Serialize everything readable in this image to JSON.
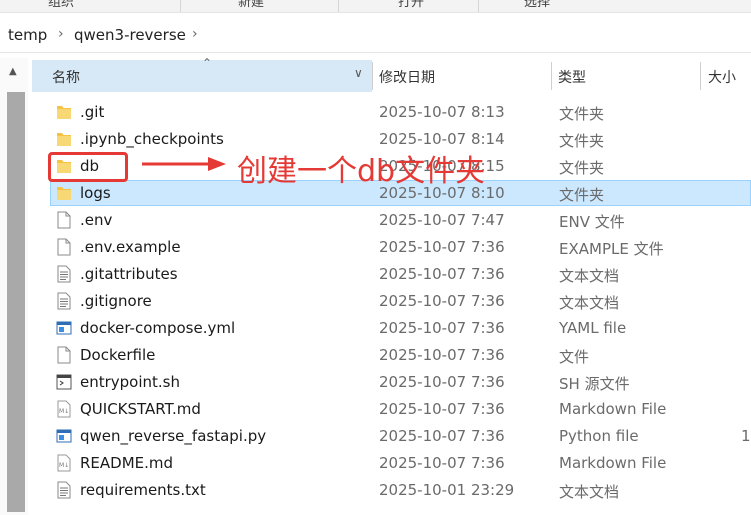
{
  "ribbon": {
    "items": [
      "组织",
      "新建",
      "打开",
      "选择"
    ]
  },
  "breadcrumb": {
    "items": [
      "temp",
      "qwen3-reverse"
    ]
  },
  "columns": {
    "name": "名称",
    "date": "修改日期",
    "type": "类型",
    "size": "大小"
  },
  "files": [
    {
      "name": ".git",
      "date": "2025-10-07 8:13",
      "type": "文件夹",
      "size": "",
      "icon": "folder"
    },
    {
      "name": ".ipynb_checkpoints",
      "date": "2025-10-07 8:14",
      "type": "文件夹",
      "size": "",
      "icon": "folder"
    },
    {
      "name": "db",
      "date": "2025-10-07 8:15",
      "type": "文件夹",
      "size": "",
      "icon": "folder"
    },
    {
      "name": "logs",
      "date": "2025-10-07 8:10",
      "type": "文件夹",
      "size": "",
      "icon": "folder"
    },
    {
      "name": ".env",
      "date": "2025-10-07 7:47",
      "type": "ENV 文件",
      "size": "",
      "icon": "blank-file"
    },
    {
      "name": ".env.example",
      "date": "2025-10-07 7:36",
      "type": "EXAMPLE 文件",
      "size": "",
      "icon": "blank-file"
    },
    {
      "name": ".gitattributes",
      "date": "2025-10-07 7:36",
      "type": "文本文档",
      "size": "",
      "icon": "text-file"
    },
    {
      "name": ".gitignore",
      "date": "2025-10-07 7:36",
      "type": "文本文档",
      "size": "",
      "icon": "text-file"
    },
    {
      "name": "docker-compose.yml",
      "date": "2025-10-07 7:36",
      "type": "YAML file",
      "size": "",
      "icon": "app-file"
    },
    {
      "name": "Dockerfile",
      "date": "2025-10-07 7:36",
      "type": "文件",
      "size": "",
      "icon": "blank-file"
    },
    {
      "name": "entrypoint.sh",
      "date": "2025-10-07 7:36",
      "type": "SH 源文件",
      "size": "",
      "icon": "script-file"
    },
    {
      "name": "QUICKSTART.md",
      "date": "2025-10-07 7:36",
      "type": "Markdown File",
      "size": "",
      "icon": "markdown-file"
    },
    {
      "name": "qwen_reverse_fastapi.py",
      "date": "2025-10-07 7:36",
      "type": "Python file",
      "size": "1",
      "icon": "app-file"
    },
    {
      "name": "README.md",
      "date": "2025-10-07 7:36",
      "type": "Markdown File",
      "size": "",
      "icon": "markdown-file"
    },
    {
      "name": "requirements.txt",
      "date": "2025-10-01 23:29",
      "type": "文本文档",
      "size": "",
      "icon": "text-file"
    }
  ],
  "selected_index": 3,
  "annotation": {
    "text": "创建一个db文件夹",
    "color": "#e53935"
  },
  "colors": {
    "folder": "#f5c342",
    "selection": "#cce8ff",
    "header_active": "#d7e9f7"
  }
}
